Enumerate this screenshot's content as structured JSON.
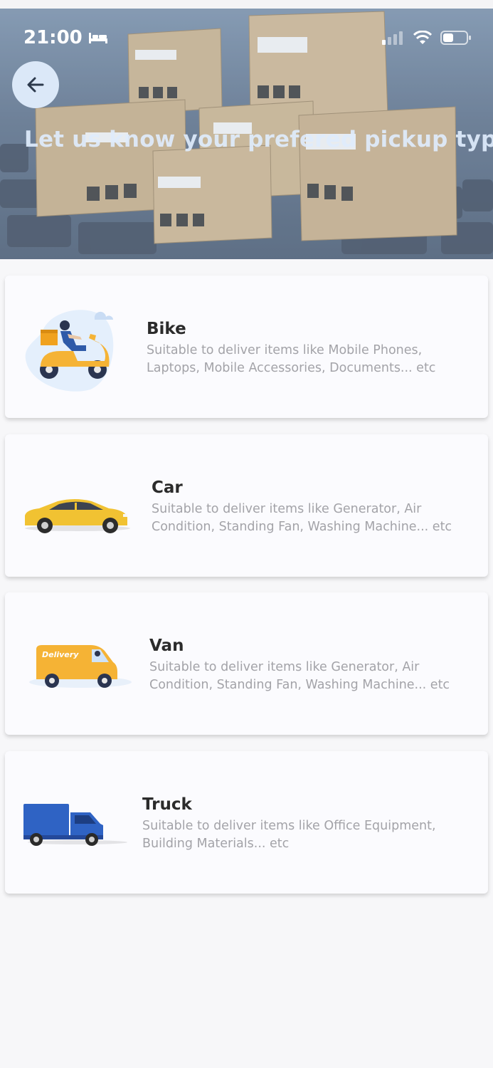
{
  "status_bar": {
    "time": "21:00"
  },
  "header": {
    "title": "Let us know your prefered pickup type."
  },
  "pickup_types": [
    {
      "name": "Bike",
      "description": "Suitable to deliver items like Mobile Phones, Laptops, Mobile Accessories, Documents... etc"
    },
    {
      "name": "Car",
      "description": "Suitable to deliver items like Generator, Air Condition, Standing Fan, Washing Machine... etc"
    },
    {
      "name": "Van",
      "van_logo_text": "Delivery",
      "description": "Suitable to deliver items like Generator, Air Condition, Standing Fan, Washing Machine... etc"
    },
    {
      "name": "Truck",
      "description": "Suitable to deliver items like Office Equipment, Building Materials... etc"
    }
  ],
  "colors": {
    "accent_yellow": "#f5b335",
    "truck_blue": "#2f63c4",
    "back_button_bg": "#dbe8f8",
    "card_bg": "#fbfbfe"
  }
}
